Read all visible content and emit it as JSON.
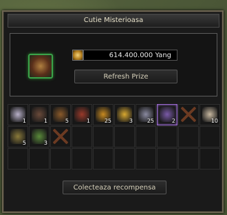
{
  "window": {
    "title": "Cutie Misterioasa"
  },
  "yang": {
    "amount": "614.400.000 Yang"
  },
  "buttons": {
    "refresh": "Refresh Prize",
    "collect": "Colecteaza recompensa"
  },
  "reward_slots": [
    {
      "icon": "ring-icon",
      "count": "1",
      "color": "#b8b0c8"
    },
    {
      "icon": "claw-icon",
      "count": "1",
      "color": "#6a4a3a"
    },
    {
      "icon": "charm-book-icon",
      "count": "5",
      "color": "#8a5a2a"
    },
    {
      "icon": "emblem-icon",
      "count": "1",
      "color": "#9a3a2a"
    },
    {
      "icon": "gold-ore-icon",
      "count": "25",
      "color": "#c88a20"
    },
    {
      "icon": "golden-scroll-icon",
      "count": "3",
      "color": "#d8a830"
    },
    {
      "icon": "crystal-shard-icon",
      "count": "25",
      "color": "#8a8aa0"
    },
    {
      "icon": "purple-ore-icon",
      "count": "2",
      "color": "#7a5aa8"
    },
    {
      "icon": "crossed-sticks-icon",
      "count": "",
      "color": ""
    },
    {
      "icon": "shell-icon",
      "count": "10",
      "color": "#c8b8a0"
    },
    {
      "icon": "staff-icon",
      "count": "5",
      "color": "#8a7a3a"
    },
    {
      "icon": "herb-icon",
      "count": "3",
      "color": "#5a8a3a"
    },
    {
      "icon": "crossed-sticks-icon",
      "count": "",
      "color": ""
    }
  ]
}
